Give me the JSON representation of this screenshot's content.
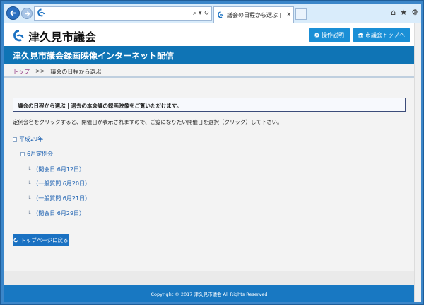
{
  "browser": {
    "tab_title": "議会の日程から選ぶ | 津久...",
    "tab_close": "×",
    "address_tools": [
      "⌕",
      "▾",
      "↻"
    ],
    "chrome_icons": [
      "⌂",
      "★",
      "⚙"
    ]
  },
  "header": {
    "logo_text": "津久見市議会",
    "manual_button": "操作説明",
    "top_button": "市議会トップへ"
  },
  "title_bar": {
    "title": "津久見市議会録画映像インターネット配信"
  },
  "breadcrumb": {
    "home": "トップ",
    "separator": ">>",
    "current": "議会の日程から選ぶ"
  },
  "notice": {
    "text": "議会の日程から選ぶ | 過去の本会議の録画映像をご覧いただけます。"
  },
  "instruction": "定例会名をクリックすると、開催日が表示されますので、ご覧になりたい開催日を選択（クリック）して下さい。",
  "tree": {
    "year": "平成29年",
    "session": "6月定例会",
    "days": [
      "（開会日 6月12日）",
      "（一般質問 6月20日）",
      "（一般質問 6月21日）",
      "（閉会日 6月29日）"
    ],
    "expander": "−",
    "branch": "└"
  },
  "back_button": "トップページに戻る",
  "footer": {
    "copyright": "Copyright © 2017 津久見市議会 All Rights Reserved"
  },
  "colors": {
    "brand_blue": "#0f74b5",
    "button_blue": "#1a8fd6",
    "link_blue": "#1a5fb0",
    "breadcrumb_link": "#8b2a7a"
  }
}
